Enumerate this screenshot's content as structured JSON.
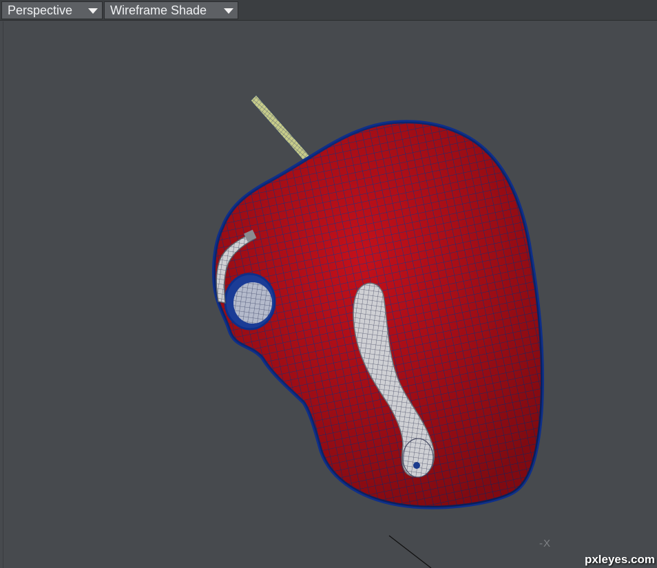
{
  "toolbar": {
    "view_mode": "Perspective",
    "shading_mode": "Wireframe Shade"
  },
  "viewport": {
    "axis_label": "-X",
    "watermark": "pxleyes.com",
    "colors": {
      "background": "#474a4e",
      "apple_fill": "#c4101a",
      "wireframe": "#1a3a8c",
      "worm": "#c8c8cc",
      "stem": "#c7cc8a"
    }
  }
}
